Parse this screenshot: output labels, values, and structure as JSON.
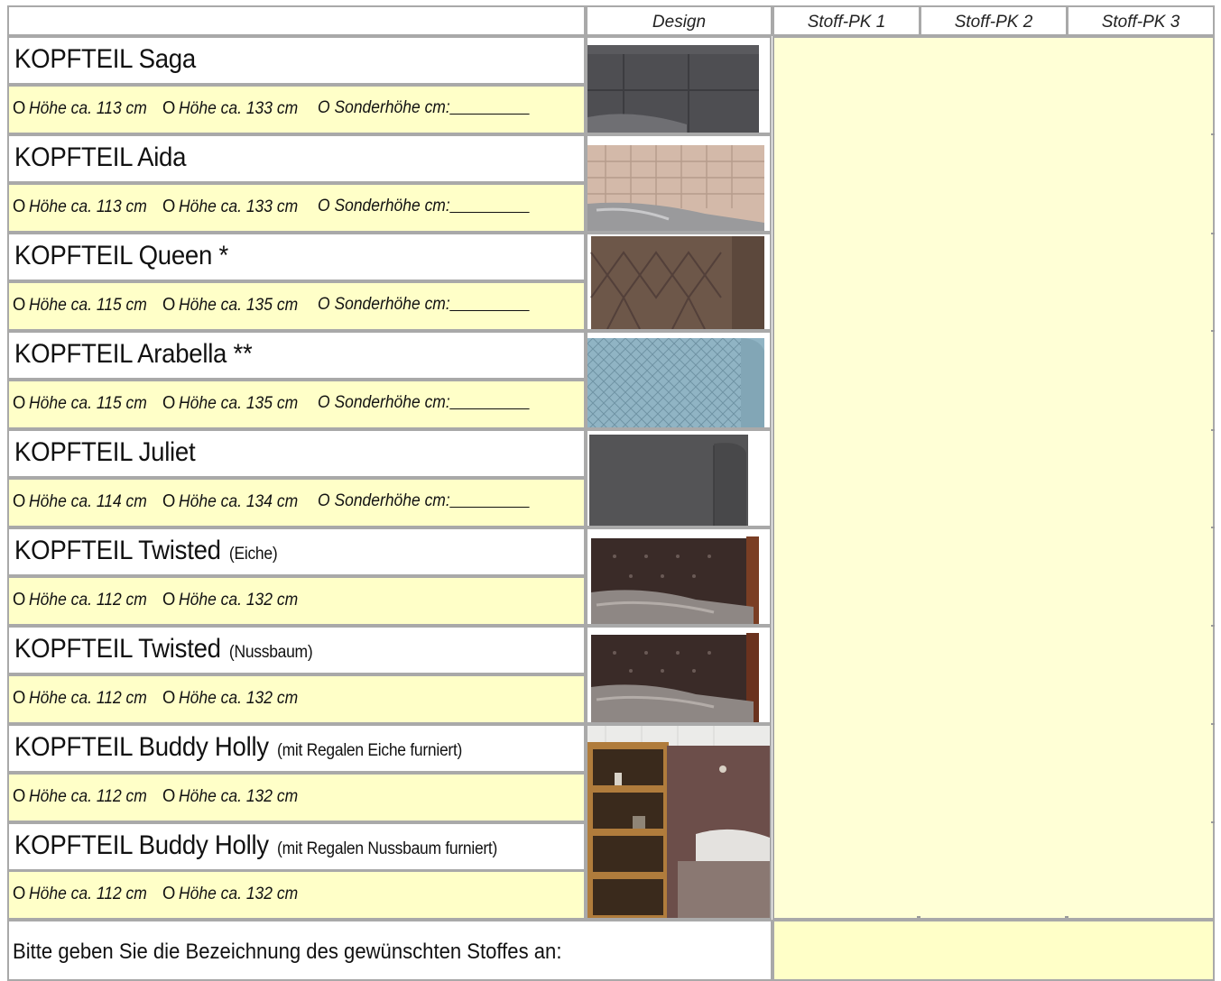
{
  "header": {
    "design": "Design",
    "stoff1": "Stoff-PK 1",
    "stoff2": "Stoff-PK 2",
    "stoff3": "Stoff-PK 3"
  },
  "products": [
    {
      "title": "KOPFTEIL Saga",
      "subtitle": "",
      "options": [
        "Höhe ca. 113 cm",
        "Höhe ca. 133 cm"
      ],
      "special": "Sonderhöhe cm:",
      "image": "headboard-saga",
      "color": "#4a4a4e"
    },
    {
      "title": "KOPFTEIL Aida",
      "subtitle": "",
      "options": [
        "Höhe ca. 113 cm",
        "Höhe ca. 133 cm"
      ],
      "special": "Sonderhöhe cm:",
      "image": "headboard-aida",
      "color": "#cdb3a3"
    },
    {
      "title": "KOPFTEIL Queen *",
      "subtitle": "",
      "options": [
        "Höhe ca. 115 cm",
        "Höhe ca. 135 cm"
      ],
      "special": "Sonderhöhe cm:",
      "image": "headboard-queen",
      "color": "#6b5548"
    },
    {
      "title": "KOPFTEIL Arabella **",
      "subtitle": "",
      "options": [
        "Höhe ca. 115 cm",
        "Höhe ca. 135 cm"
      ],
      "special": "Sonderhöhe cm:",
      "image": "headboard-arabella",
      "color": "#8cb0c0"
    },
    {
      "title": "KOPFTEIL Juliet",
      "subtitle": "",
      "options": [
        "Höhe ca. 114 cm",
        "Höhe ca. 134 cm"
      ],
      "special": "Sonderhöhe cm:",
      "image": "headboard-juliet",
      "color": "#505052"
    },
    {
      "title": "KOPFTEIL Twisted",
      "subtitle": "(Eiche)",
      "options": [
        "Höhe ca. 112 cm",
        "Höhe ca. 132 cm"
      ],
      "special": "",
      "image": "headboard-twisted-eiche",
      "color": "#3a2a26"
    },
    {
      "title": "KOPFTEIL Twisted",
      "subtitle": "(Nussbaum)",
      "options": [
        "Höhe ca. 112 cm",
        "Höhe ca. 132 cm"
      ],
      "special": "",
      "image": "headboard-twisted-nussbaum",
      "color": "#3a2a26"
    },
    {
      "title": "KOPFTEIL Buddy Holly",
      "subtitle": "(mit Regalen Eiche furniert)",
      "options": [
        "Höhe ca. 112 cm",
        "Höhe ca. 132 cm"
      ],
      "special": "",
      "image": "headboard-buddy-holly",
      "color": "#6a4c48"
    },
    {
      "title": "KOPFTEIL Buddy Holly",
      "subtitle": "(mit Regalen Nussbaum furniert)",
      "options": [
        "Höhe ca. 112 cm",
        "Höhe ca. 132 cm"
      ],
      "special": "",
      "image": "headboard-buddy-holly",
      "color": "#6a4c48"
    }
  ],
  "option_marker": "O",
  "footer": {
    "prompt": "Bitte geben Sie die Bezeichnung des gewünschten Stoffes an:",
    "fabric_value": ""
  }
}
